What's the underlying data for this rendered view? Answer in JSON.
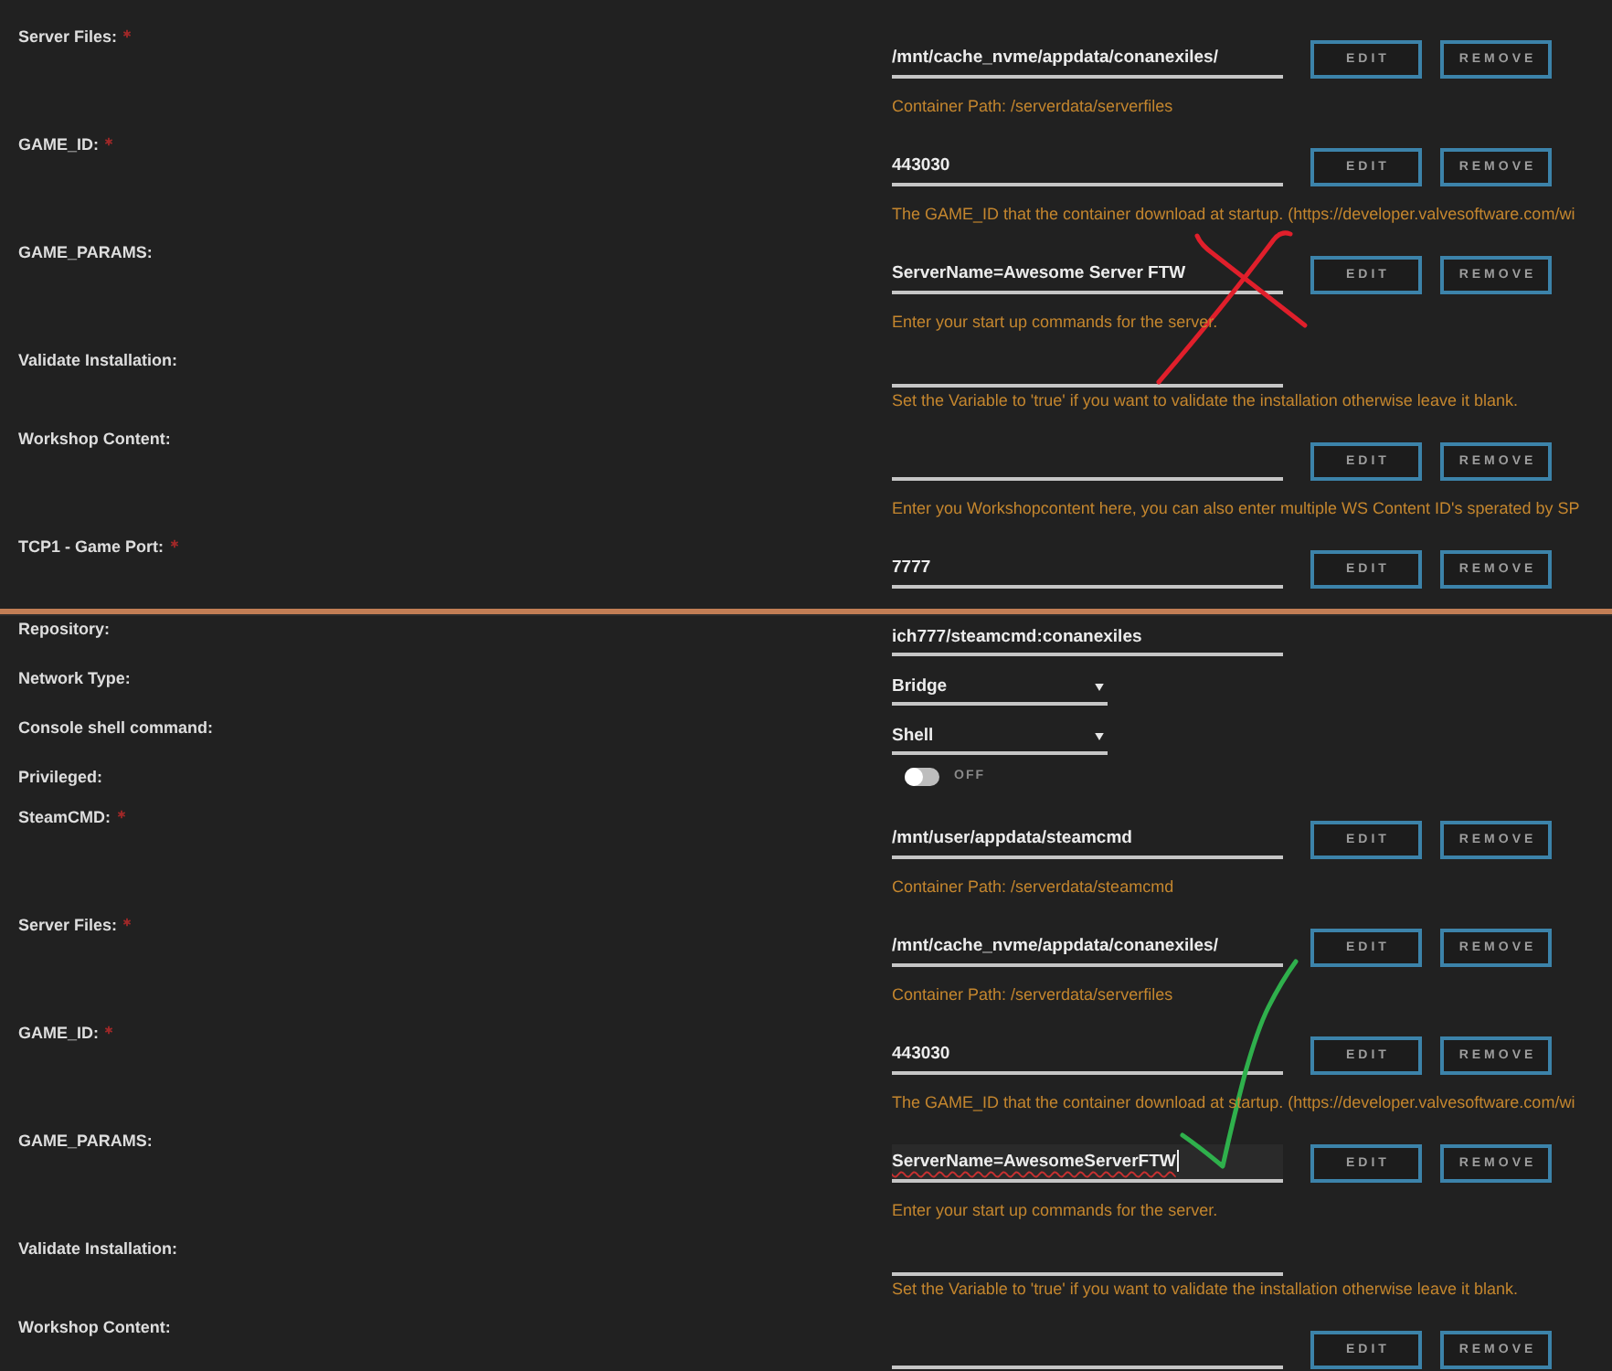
{
  "panels": [
    {
      "rows": [
        {
          "kind": "text",
          "label": "Server Files:",
          "required": true,
          "value": "/mnt/cache_nvme/appdata/conanexiles/",
          "focused": false,
          "misspelled": false,
          "buttons": [
            {
              "kind": "edit",
              "label": "EDIT"
            },
            {
              "kind": "remove",
              "label": "REMOVE"
            }
          ],
          "hint": "Container Path: /serverdata/serverfiles"
        },
        {
          "kind": "text",
          "label": "GAME_ID:",
          "required": true,
          "value": "443030",
          "focused": false,
          "misspelled": false,
          "buttons": [
            {
              "kind": "edit",
              "label": "EDIT"
            },
            {
              "kind": "remove",
              "label": "REMOVE"
            }
          ],
          "hint": "The GAME_ID that the container download at startup. (https://developer.valvesoftware.com/wi"
        },
        {
          "kind": "text",
          "label": "GAME_PARAMS:",
          "required": false,
          "value": "ServerName=Awesome Server FTW",
          "focused": false,
          "misspelled": false,
          "buttons": [
            {
              "kind": "edit",
              "label": "EDIT"
            },
            {
              "kind": "remove",
              "label": "REMOVE"
            }
          ],
          "hint": "Enter your start up commands for the server.",
          "annotation": {
            "kind": "cross"
          }
        },
        {
          "kind": "text",
          "label": "Validate Installation:",
          "required": false,
          "focused": false,
          "hint": "Set the Variable to 'true' if you want to validate the installation otherwise leave it blank."
        },
        {
          "kind": "text",
          "label": "Workshop Content:",
          "required": false,
          "focused": false,
          "buttons": [
            {
              "kind": "edit",
              "label": "EDIT"
            },
            {
              "kind": "remove",
              "label": "REMOVE"
            }
          ],
          "hint": "Enter you Workshopcontent here, you can also enter multiple WS Content ID's sperated by SP"
        },
        {
          "kind": "text",
          "label": "TCP1 - Game Port:",
          "required": true,
          "value": "7777",
          "focused": false,
          "misspelled": false,
          "buttons": [
            {
              "kind": "edit",
              "label": "EDIT"
            },
            {
              "kind": "remove",
              "label": "REMOVE"
            }
          ]
        }
      ]
    },
    {
      "rows": [
        {
          "kind": "text",
          "label": "Repository:",
          "required": false,
          "value": "ich777/steamcmd:conanexiles",
          "focused": false,
          "misspelled": false
        },
        {
          "kind": "select",
          "label": "Network Type:",
          "required": false,
          "value": "Bridge"
        },
        {
          "kind": "select",
          "label": "Console shell command:",
          "required": false,
          "value": "Shell"
        },
        {
          "kind": "toggle",
          "label": "Privileged:",
          "required": false,
          "on": false,
          "state_label": "OFF"
        },
        {
          "kind": "text",
          "label": "SteamCMD:",
          "required": true,
          "value": "/mnt/user/appdata/steamcmd",
          "focused": false,
          "misspelled": false,
          "buttons": [
            {
              "kind": "edit",
              "label": "EDIT"
            },
            {
              "kind": "remove",
              "label": "REMOVE"
            }
          ],
          "hint": "Container Path: /serverdata/steamcmd"
        },
        {
          "kind": "text",
          "label": "Server Files:",
          "required": true,
          "value": "/mnt/cache_nvme/appdata/conanexiles/",
          "focused": false,
          "misspelled": false,
          "buttons": [
            {
              "kind": "edit",
              "label": "EDIT"
            },
            {
              "kind": "remove",
              "label": "REMOVE"
            }
          ],
          "hint": "Container Path: /serverdata/serverfiles"
        },
        {
          "kind": "text",
          "label": "GAME_ID:",
          "required": true,
          "value": "443030",
          "focused": false,
          "misspelled": false,
          "buttons": [
            {
              "kind": "edit",
              "label": "EDIT"
            },
            {
              "kind": "remove",
              "label": "REMOVE"
            }
          ],
          "hint": "The GAME_ID that the container download at startup. (https://developer.valvesoftware.com/wi"
        },
        {
          "kind": "text",
          "label": "GAME_PARAMS:",
          "required": false,
          "value": "ServerName=AwesomeServerFTW",
          "focused": true,
          "misspelled": true,
          "buttons": [
            {
              "kind": "edit",
              "label": "EDIT"
            },
            {
              "kind": "remove",
              "label": "REMOVE"
            }
          ],
          "hint": "Enter your start up commands for the server.",
          "annotation": {
            "kind": "check"
          }
        },
        {
          "kind": "text",
          "label": "Validate Installation:",
          "required": false,
          "focused": false,
          "hint": "Set the Variable to 'true' if you want to validate the installation otherwise leave it blank."
        },
        {
          "kind": "text",
          "label": "Workshop Content:",
          "required": false,
          "focused": false,
          "buttons": [
            {
              "kind": "edit",
              "label": "EDIT"
            },
            {
              "kind": "remove",
              "label": "REMOVE"
            }
          ]
        }
      ]
    }
  ]
}
